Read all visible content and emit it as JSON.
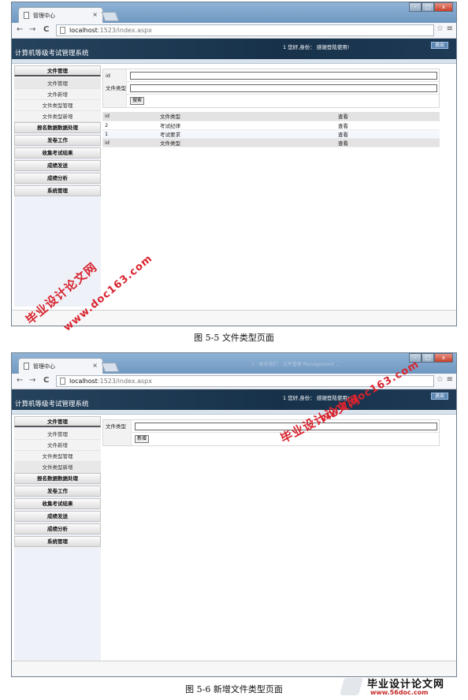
{
  "browser": {
    "tab_title": "管理中心",
    "tab_close": "×",
    "ghost_tab": "1 - 联系我们 - 文件管理 Management ...",
    "win_min": "-",
    "win_max": "□",
    "win_close": "x",
    "back": "←",
    "forward": "→",
    "reload": "C",
    "address_host": "localhost",
    "address_path": ":1523/index.aspx",
    "star": "☆",
    "menu": "≡"
  },
  "header": {
    "site_title": "计算机等级考试管理系统",
    "greeting": "1 您好,身份：  感谢登陆使用!",
    "logout_label": "退出"
  },
  "sidebar": {
    "file_mgmt": "文件管理",
    "sub_items": [
      "文件管理",
      "文件新增",
      "文件类型管理",
      "文件类型新增"
    ],
    "sections": [
      "报名数据数据处理",
      "发卷工作",
      "收集考试结果",
      "成绩发送",
      "成绩分析",
      "系统管理"
    ]
  },
  "screen1": {
    "form": {
      "id_label": "id",
      "type_label": "文件类型",
      "id_value": "",
      "type_value": "",
      "search_label": "搜索"
    },
    "table": {
      "columns": [
        "id",
        "文件类型",
        "查看"
      ],
      "rows": [
        [
          "2",
          "考试纪律",
          "查看"
        ],
        [
          "1",
          "考试要求",
          "查看"
        ]
      ],
      "footer": [
        "id",
        "文件类型",
        "查看"
      ]
    }
  },
  "screen2": {
    "form": {
      "type_label": "文件类型",
      "type_value": "",
      "add_label": "新增"
    }
  },
  "captions": {
    "fig1": "图 5-5 文件类型页面",
    "fig2": "图 5-6 新增文件类型页面"
  },
  "watermarks": {
    "cn": "毕业设计论文网",
    "url": "www.doc163.com"
  },
  "footer_logo": {
    "text": "毕业设计论文网",
    "url": "www.56doc.com"
  }
}
